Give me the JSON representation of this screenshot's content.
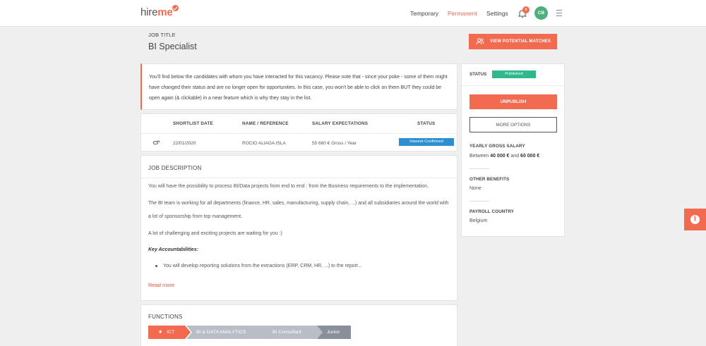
{
  "brand": {
    "logo_hire": "hire",
    "logo_me": "me"
  },
  "nav": {
    "links": [
      "Temporary",
      "Permanent",
      "Settings"
    ],
    "active": "Permanent",
    "notifications_count": "8",
    "avatar_initials": "CB"
  },
  "job": {
    "title_label": "JOB TITLE",
    "title": "BI Specialist",
    "view_matches_label": "VIEW POTENTIAL MATCHES"
  },
  "notice": {
    "text": "You'll find below the candidates with whom you have interacted for this vacancy. Please note that - since your poke - some of them might have changed their status and are no longer open for opportunities. In this case, you won't be able to click on them BUT they could be open again (& clickable) in a near feature which is why they stay in the list."
  },
  "shortlist": {
    "columns": [
      "SHORTLIST DATE",
      "NAME / REFERENCE",
      "SALARY EXPECTATIONS",
      "STATUS"
    ],
    "rows": [
      {
        "date": "22/01/2020",
        "name": "ROCIO ALIAGA ISLA",
        "salary": "55 680 € Gross / Year",
        "status": "Interest Confirmed"
      }
    ]
  },
  "description": {
    "title": "JOB DESCRIPTION",
    "p1": "You will have the possibility to process BI/Data projects from end to end : from the Business requirements to the implementation.",
    "p2": "The BI team is working for all departments (finance, HR, sales, manufacturing, supply chain, ...) and all subsidiaries around the world with a lot of sponsorship from top management.",
    "p3": "A lot of challenging and exciting projects are waiting for you :)",
    "accountabilities": "Key Accountabilities:",
    "bullet": "You will develop reporting solutions from the extractions (ERP, CRM, HR, ...) to the report...",
    "read_more": "Read more"
  },
  "functions": {
    "title": "FUNCTIONS",
    "path": [
      "ICT",
      "BI & DATA ANALYTICS",
      "BI Consultant",
      "Junior"
    ]
  },
  "sidebar": {
    "status_label": "STATUS",
    "status_value": "Published",
    "unpublish_label": "UNPUBLISH",
    "more_options_label": "MORE OPTIONS",
    "salary_label": "YEARLY GROSS SALARY",
    "salary_between": "Between",
    "salary_min": "40 000 €",
    "salary_and": "and",
    "salary_max": "60 000 €",
    "benefits_label": "OTHER BENEFITS",
    "benefits_value": "None",
    "payroll_label": "PAYROLL COUNTRY",
    "payroll_value": "Belgium"
  },
  "colors": {
    "accent": "#f26a4f",
    "published": "#2eb88c",
    "status_blue": "#2d8fd0",
    "avatar": "#4caf7d",
    "chevron_gray": "#b9bec6",
    "chevron_dark": "#8a9099"
  }
}
